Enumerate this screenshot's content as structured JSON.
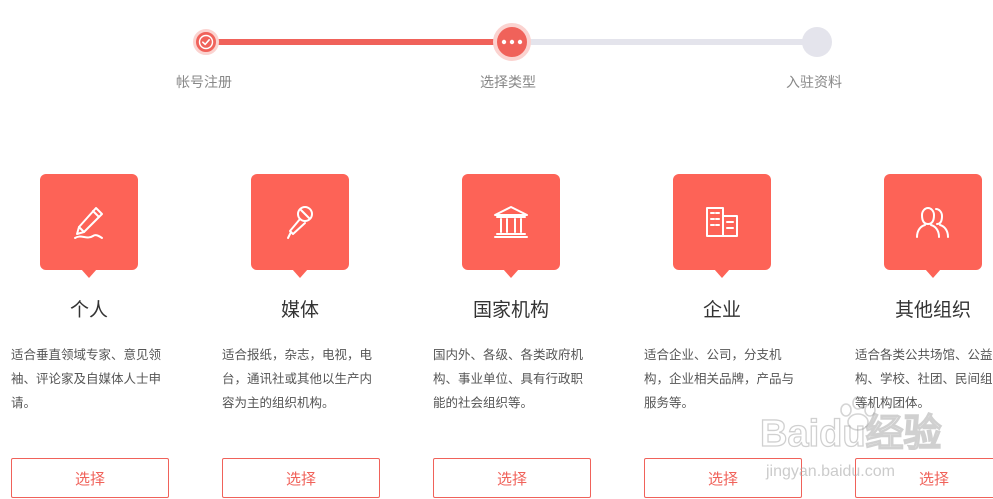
{
  "steps": [
    {
      "label": "帐号注册",
      "state": "done",
      "icon": "check-icon"
    },
    {
      "label": "选择类型",
      "state": "current",
      "icon": "more-dots-icon"
    },
    {
      "label": "入驻资料",
      "state": "pending"
    }
  ],
  "colors": {
    "accent": "#f0625a",
    "icon_bg": "#fd6357",
    "track_inactive": "#e4e4ec"
  },
  "cards": [
    {
      "title": "个人",
      "desc": "适合垂直领域专家、意见领袖、评论家及自媒体人士申请。",
      "button": "选择",
      "icon": "pen-icon"
    },
    {
      "title": "媒体",
      "desc": "适合报纸，杂志，电视，电台，通讯社或其他以生产内容为主的组织机构。",
      "button": "选择",
      "icon": "microphone-icon"
    },
    {
      "title": "国家机构",
      "desc": "国内外、各级、各类政府机构、事业单位、具有行政职能的社会组织等。",
      "button": "选择",
      "icon": "government-building-icon"
    },
    {
      "title": "企业",
      "desc": "适合企业、公司，分支机构，企业相关品牌，产品与服务等。",
      "button": "选择",
      "icon": "office-building-icon"
    },
    {
      "title": "其他组织",
      "desc": "适合各类公共场馆、公益机构、学校、社团、民间组织等机构团体。",
      "button": "选择",
      "icon": "people-icon"
    }
  ],
  "watermark": {
    "text": "Baidu经验",
    "url_text": "jingyan.baidu.com"
  }
}
